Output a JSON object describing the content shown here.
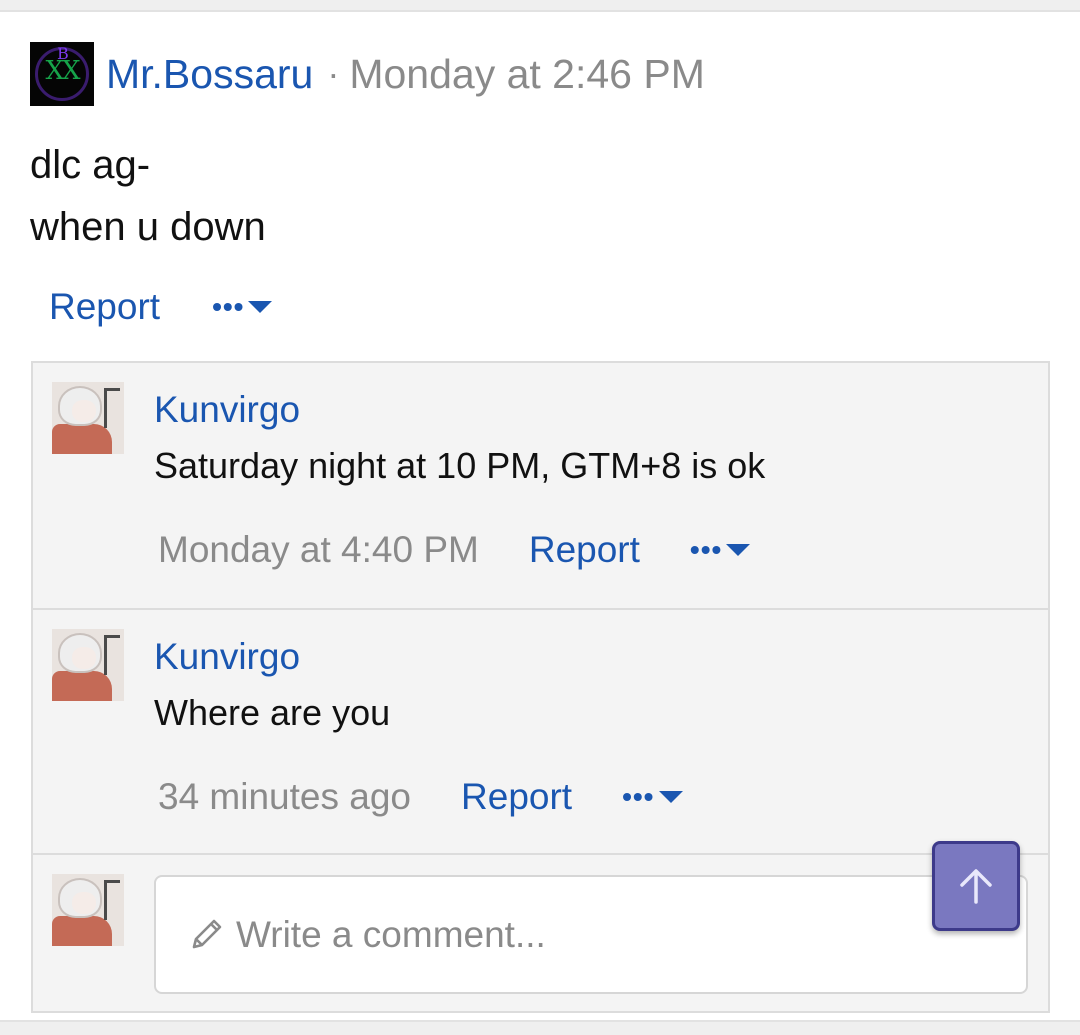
{
  "post": {
    "author": "Mr.Bossaru",
    "separator": "·",
    "time": "Monday at 2:46 PM",
    "lines": [
      "dlc ag-",
      "when u down"
    ],
    "report_label": "Report",
    "more_label": "•••"
  },
  "comments": [
    {
      "author": "Kunvirgo",
      "text": "Saturday night at 10 PM, GTM+8 is ok",
      "time": "Monday at 4:40 PM",
      "report_label": "Report",
      "more_label": "•••"
    },
    {
      "author": "Kunvirgo",
      "text": "Where are you",
      "time": "34 minutes ago",
      "report_label": "Report",
      "more_label": "•••"
    }
  ],
  "reply": {
    "placeholder": "Write a comment..."
  },
  "icons": {
    "post_avatar": "mr-bossaru-avatar",
    "comment_avatar": "kunvirgo-avatar",
    "more": "ellipsis-caret-icon",
    "write": "pencil-icon",
    "scroll_top": "arrow-up-icon"
  },
  "colors": {
    "link": "#1a56b0",
    "muted": "#8a8a8a",
    "scroll_button": "#7a78c0"
  }
}
